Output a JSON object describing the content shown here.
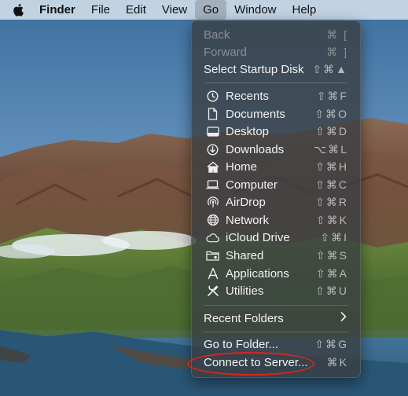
{
  "menubar": {
    "app_name": "Finder",
    "items": [
      "File",
      "Edit",
      "View",
      "Go",
      "Window",
      "Help"
    ],
    "active_item": "Go"
  },
  "go_menu": {
    "back": {
      "label": "Back",
      "shortcut": "⌘ ["
    },
    "forward": {
      "label": "Forward",
      "shortcut": "⌘ ]"
    },
    "startup": {
      "label": "Select Startup Disk",
      "shortcut": "⇧⌘▲"
    },
    "places": [
      {
        "label": "Recents",
        "shortcut": "⇧⌘F",
        "icon": "clock-icon"
      },
      {
        "label": "Documents",
        "shortcut": "⇧⌘O",
        "icon": "document-icon"
      },
      {
        "label": "Desktop",
        "shortcut": "⇧⌘D",
        "icon": "desktop-icon"
      },
      {
        "label": "Downloads",
        "shortcut": "⌥⌘L",
        "icon": "download-icon"
      },
      {
        "label": "Home",
        "shortcut": "⇧⌘H",
        "icon": "home-icon"
      },
      {
        "label": "Computer",
        "shortcut": "⇧⌘C",
        "icon": "laptop-icon"
      },
      {
        "label": "AirDrop",
        "shortcut": "⇧⌘R",
        "icon": "airdrop-icon"
      },
      {
        "label": "Network",
        "shortcut": "⇧⌘K",
        "icon": "globe-icon"
      },
      {
        "label": "iCloud Drive",
        "shortcut": "⇧⌘I",
        "icon": "cloud-icon"
      },
      {
        "label": "Shared",
        "shortcut": "⇧⌘S",
        "icon": "shared-folder-icon"
      },
      {
        "label": "Applications",
        "shortcut": "⇧⌘A",
        "icon": "applications-icon"
      },
      {
        "label": "Utilities",
        "shortcut": "⇧⌘U",
        "icon": "utilities-icon"
      }
    ],
    "recent_folders": {
      "label": "Recent Folders"
    },
    "go_to_folder": {
      "label": "Go to Folder...",
      "shortcut": "⇧⌘G"
    },
    "connect_to_server": {
      "label": "Connect to Server...",
      "shortcut": "⌘K"
    }
  },
  "colors": {
    "menu_bg": "#3a3e42",
    "annotation": "#d9251e"
  }
}
